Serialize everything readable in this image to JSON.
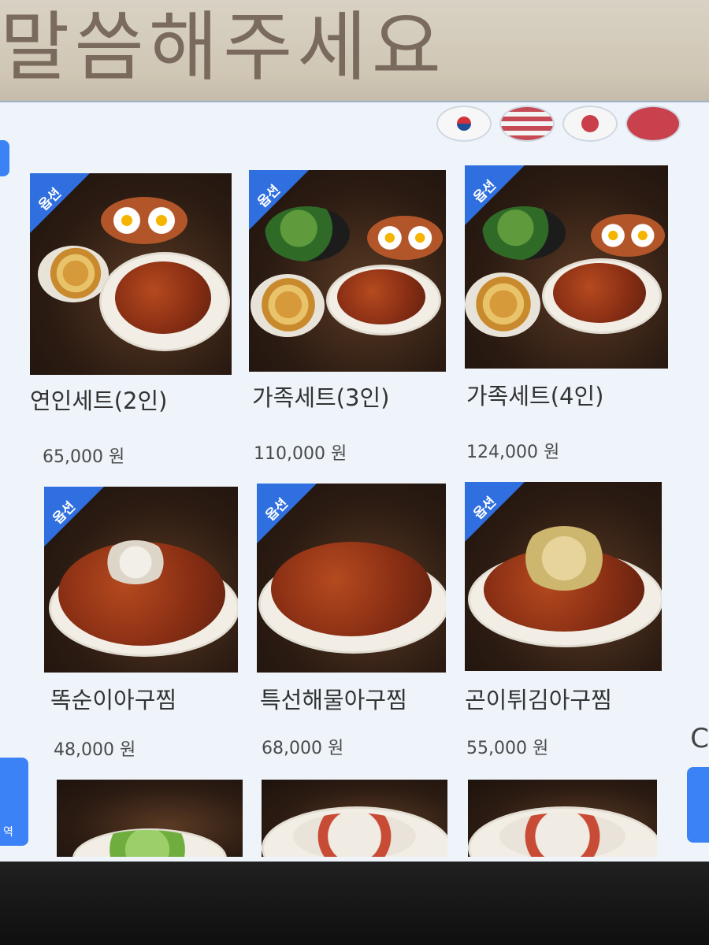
{
  "sign": {
    "text": "말씀해주세요"
  },
  "languages": [
    {
      "name": "korean-flag"
    },
    {
      "name": "us-flag"
    },
    {
      "name": "japan-flag"
    },
    {
      "name": "china-flag"
    }
  ],
  "badge_label": "옵션",
  "side": {
    "left_tab_label": "역",
    "right_glyph": "C"
  },
  "menu": [
    {
      "name": "연인세트(2인)",
      "price": "65,000 원",
      "has_badge": true
    },
    {
      "name": "가족세트(3인)",
      "price": "110,000 원",
      "has_badge": true
    },
    {
      "name": "가족세트(4인)",
      "price": "124,000 원",
      "has_badge": true
    },
    {
      "name": "똑순이아구찜",
      "price": "48,000 원",
      "has_badge": true
    },
    {
      "name": "특선해물아구찜",
      "price": "68,000 원",
      "has_badge": true
    },
    {
      "name": "곤이튀김아구찜",
      "price": "55,000 원",
      "has_badge": true
    }
  ],
  "colors": {
    "accent": "#2f6fdf",
    "screen_bg": "#eef4fa"
  }
}
